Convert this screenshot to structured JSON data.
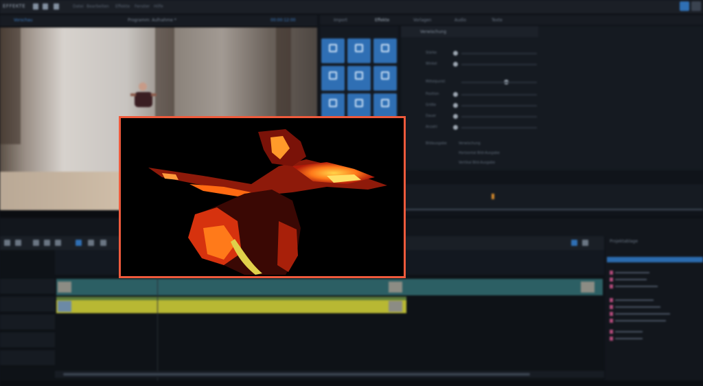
{
  "app": {
    "brand": "EFFEKTE",
    "menu": [
      "Datei",
      "Bearbeiten",
      "Effekte",
      "Fenster",
      "Hilfe"
    ]
  },
  "preview": {
    "left_label": "Vorschau",
    "center_label": "Programm: Aufnahme *",
    "right_label": "00:00:12:00"
  },
  "effects_tabs": [
    "Import",
    "Effekte",
    "Vorlagen",
    "Audio",
    "Texte"
  ],
  "settings": {
    "header": "Verwischung",
    "rows": [
      "Stärke",
      "Winkel",
      "Mittelpunkt",
      "Position",
      "Größe",
      "Dauer",
      "Anzahl"
    ],
    "options": [
      "Verwischung",
      "Horizontal Bild-Ausgabe",
      "Vertikal Bild-Ausgabe"
    ],
    "options_label": "Bildausgabe"
  },
  "media_pool": {
    "title": "Projektablage"
  },
  "colors": {
    "accent_blue": "#2f6fb4",
    "highlight_border": "#ef5a3c",
    "clip_teal": "#2c5f64",
    "clip_yellow": "#b8b833",
    "marker_orange": "#d48a2c"
  }
}
